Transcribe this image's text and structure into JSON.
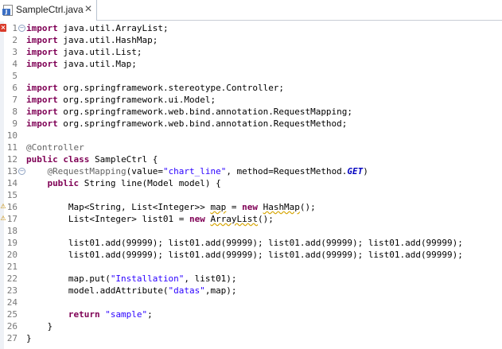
{
  "tab": {
    "title": "SampleCtrl.java",
    "close_glyph": "✕",
    "icon": "java-file-icon",
    "icon_badge": "J"
  },
  "editor": {
    "lines": [
      {
        "num": "1",
        "fold": "⊖",
        "marker": "error",
        "parts": [
          [
            "kw",
            "import"
          ],
          [
            "n",
            " java.util.ArrayList;"
          ]
        ]
      },
      {
        "num": "2",
        "parts": [
          [
            "kw",
            "import"
          ],
          [
            "n",
            " java.util.HashMap;"
          ]
        ]
      },
      {
        "num": "3",
        "parts": [
          [
            "kw",
            "import"
          ],
          [
            "n",
            " java.util.List;"
          ]
        ]
      },
      {
        "num": "4",
        "parts": [
          [
            "kw",
            "import"
          ],
          [
            "n",
            " java.util.Map;"
          ]
        ]
      },
      {
        "num": "5",
        "parts": []
      },
      {
        "num": "6",
        "parts": [
          [
            "kw",
            "import"
          ],
          [
            "n",
            " org.springframework.stereotype.Controller;"
          ]
        ]
      },
      {
        "num": "7",
        "parts": [
          [
            "kw",
            "import"
          ],
          [
            "n",
            " org.springframework.ui.Model;"
          ]
        ]
      },
      {
        "num": "8",
        "parts": [
          [
            "kw",
            "import"
          ],
          [
            "n",
            " org.springframework.web.bind.annotation.RequestMapping;"
          ]
        ]
      },
      {
        "num": "9",
        "parts": [
          [
            "kw",
            "import"
          ],
          [
            "n",
            " org.springframework.web.bind.annotation.RequestMethod;"
          ]
        ]
      },
      {
        "num": "10",
        "parts": []
      },
      {
        "num": "11",
        "parts": [
          [
            "an",
            "@Controller"
          ]
        ]
      },
      {
        "num": "12",
        "parts": [
          [
            "kw",
            "public"
          ],
          [
            "n",
            " "
          ],
          [
            "kw",
            "class"
          ],
          [
            "n",
            " SampleCtrl {"
          ]
        ]
      },
      {
        "num": "13",
        "fold": "⊖",
        "parts": [
          [
            "n",
            "    "
          ],
          [
            "an",
            "@RequestMapping"
          ],
          [
            "n",
            "(value="
          ],
          [
            "st",
            "\"chart_line\""
          ],
          [
            "n",
            ", method=RequestMethod."
          ],
          [
            "fc",
            "GET"
          ],
          [
            "n",
            ")"
          ]
        ]
      },
      {
        "num": "14",
        "parts": [
          [
            "n",
            "    "
          ],
          [
            "kw",
            "public"
          ],
          [
            "n",
            " String line(Model model) {"
          ]
        ]
      },
      {
        "num": "15",
        "parts": []
      },
      {
        "num": "16",
        "marker": "warning",
        "parts": [
          [
            "n",
            "        Map<String, List<Integer>> "
          ],
          [
            "wv",
            "map"
          ],
          [
            "n",
            " = "
          ],
          [
            "kw",
            "new"
          ],
          [
            "n",
            " "
          ],
          [
            "wv",
            "HashMap"
          ],
          [
            "n",
            "();"
          ]
        ]
      },
      {
        "num": "17",
        "marker": "warning",
        "parts": [
          [
            "n",
            "        List<Integer> list01 = "
          ],
          [
            "kw",
            "new"
          ],
          [
            "n",
            " "
          ],
          [
            "wv",
            "ArrayList"
          ],
          [
            "n",
            "();"
          ]
        ]
      },
      {
        "num": "18",
        "parts": []
      },
      {
        "num": "19",
        "parts": [
          [
            "n",
            "        list01.add(99999); list01.add(99999); list01.add(99999); list01.add(99999);"
          ]
        ]
      },
      {
        "num": "20",
        "parts": [
          [
            "n",
            "        list01.add(99999); list01.add(99999); list01.add(99999); list01.add(99999);"
          ]
        ]
      },
      {
        "num": "21",
        "parts": []
      },
      {
        "num": "22",
        "parts": [
          [
            "n",
            "        map.put("
          ],
          [
            "st",
            "\"Installation\""
          ],
          [
            "n",
            ", list01);"
          ]
        ]
      },
      {
        "num": "23",
        "parts": [
          [
            "n",
            "        model.addAttribute("
          ],
          [
            "st",
            "\"datas\""
          ],
          [
            "n",
            ",map);"
          ]
        ]
      },
      {
        "num": "24",
        "parts": []
      },
      {
        "num": "25",
        "parts": [
          [
            "n",
            "        "
          ],
          [
            "kw",
            "return"
          ],
          [
            "n",
            " "
          ],
          [
            "st",
            "\"sample\""
          ],
          [
            "n",
            ";"
          ]
        ]
      },
      {
        "num": "26",
        "parts": [
          [
            "n",
            "    }"
          ]
        ]
      },
      {
        "num": "27",
        "parts": [
          [
            "n",
            "}"
          ]
        ]
      }
    ]
  },
  "colors": {
    "keyword": "#7f0055",
    "string": "#2a00ff",
    "annotation": "#646464",
    "line_number": "#787878",
    "warning_underline": "#d6a400",
    "error_marker": "#d93b2a"
  }
}
